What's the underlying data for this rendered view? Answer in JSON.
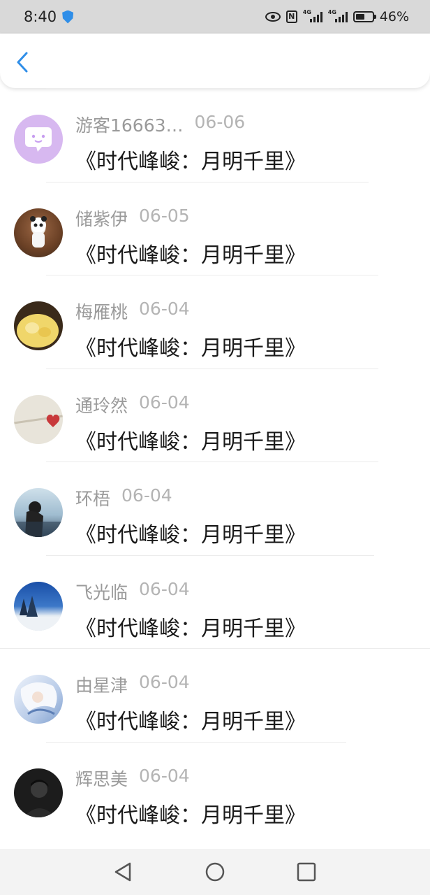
{
  "status_bar": {
    "time": "8:40",
    "battery": "46%",
    "signal_tag_1": "4G",
    "signal_tag_2": "4G"
  },
  "header": {
    "back_icon": "chevron-left-icon",
    "accent": "#2f8ee8"
  },
  "items": [
    {
      "name": "游客16663…",
      "date": "06-06",
      "title": "《时代峰峻：月明千里》"
    },
    {
      "name": "储紫伊",
      "date": "06-05",
      "title": "《时代峰峻：月明千里》"
    },
    {
      "name": "梅雁桃",
      "date": "06-04",
      "title": "《时代峰峻：月明千里》"
    },
    {
      "name": "通玲然",
      "date": "06-04",
      "title": "《时代峰峻：月明千里》"
    },
    {
      "name": "环梧",
      "date": "06-04",
      "title": "《时代峰峻：月明千里》"
    },
    {
      "name": "飞光临",
      "date": "06-04",
      "title": "《时代峰峻：月明千里》"
    },
    {
      "name": "由星津",
      "date": "06-04",
      "title": "《时代峰峻：月明千里》"
    },
    {
      "name": "辉思美",
      "date": "06-04",
      "title": "《时代峰峻：月明千里》"
    }
  ],
  "nav_bar": {
    "back_icon": "triangle-back-icon",
    "home_icon": "circle-home-icon",
    "recents_icon": "square-recents-icon"
  }
}
